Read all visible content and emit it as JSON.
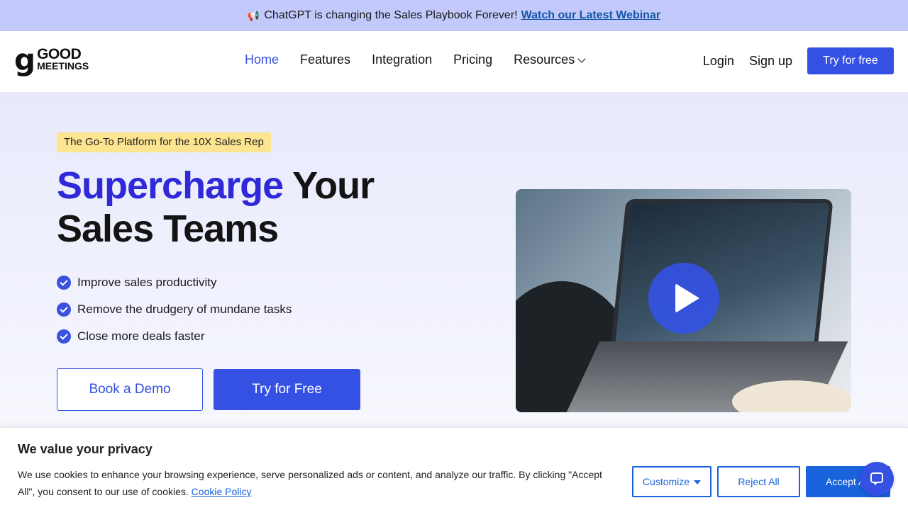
{
  "announcement": {
    "icon": "megaphone-icon",
    "text": "ChatGPT is changing the Sales Playbook Forever!",
    "link": "Watch our Latest Webinar"
  },
  "nav": {
    "logo_mark": "g",
    "logo_line1": "GOOD",
    "logo_line2": "MEETINGS",
    "items": [
      {
        "label": "Home",
        "active": true
      },
      {
        "label": "Features"
      },
      {
        "label": "Integration"
      },
      {
        "label": "Pricing"
      },
      {
        "label": "Resources",
        "dropdown": true
      }
    ],
    "login": "Login",
    "signup": "Sign up",
    "cta": "Try for free"
  },
  "hero": {
    "badge": "The Go-To Platform for the 10X Sales Rep",
    "headline_accent": "Supercharge",
    "headline_rest1": " Your",
    "headline_rest2": "Sales Teams",
    "bullets": [
      "Improve sales productivity",
      "Remove the drudgery of mundane tasks",
      "Close more deals faster"
    ],
    "demo_button": "Book a Demo",
    "free_button": "Try for Free",
    "accent_color": "#3451e3"
  },
  "cookie": {
    "title": "We value your privacy",
    "body": "We use cookies to enhance your browsing experience, serve personalized ads or content, and analyze our traffic. By clicking \"Accept All\", you consent to our use of cookies.",
    "policy_link": "Cookie Policy",
    "customize": "Customize",
    "reject": "Reject All",
    "accept": "Accept All"
  }
}
